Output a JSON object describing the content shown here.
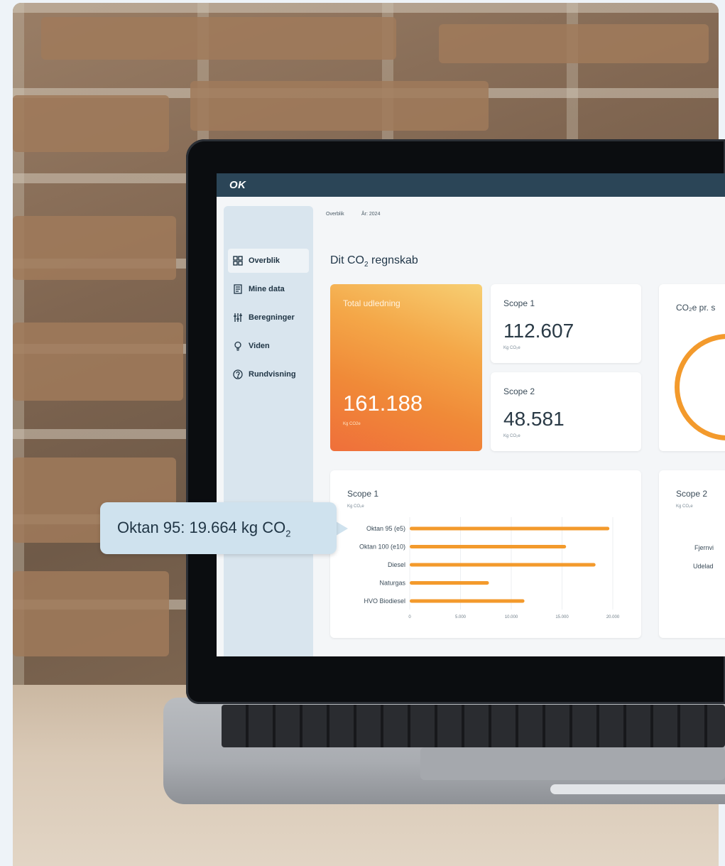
{
  "app": {
    "logo": "OK",
    "breadcrumb": {
      "page": "Overblik",
      "year": "År: 2024"
    },
    "title_main": "Dit CO",
    "title_sub": "2",
    "title_rest": " regnskab"
  },
  "sidebar": {
    "items": [
      {
        "label": "Overblik",
        "icon": "grid-icon",
        "active": true
      },
      {
        "label": "Mine data",
        "icon": "document-icon",
        "active": false
      },
      {
        "label": "Beregninger",
        "icon": "sliders-icon",
        "active": false
      },
      {
        "label": "Viden",
        "icon": "lightbulb-icon",
        "active": false
      },
      {
        "label": "Rundvisning",
        "icon": "help-circle-icon",
        "active": false
      }
    ]
  },
  "cards": {
    "total": {
      "title": "Total udledning",
      "value": "161.188",
      "unit": "Kg CO2e"
    },
    "scope1": {
      "title": "Scope 1",
      "value": "112.607",
      "unit": "Kg CO₂e"
    },
    "scope2": {
      "title": "Scope 2",
      "value": "48.581",
      "unit": "Kg CO₂e"
    },
    "co2_per": {
      "title": "CO₂e pr. s"
    },
    "scope2_chart": {
      "title": "Scope 2",
      "unit": "Kg CO₂e",
      "labels": [
        "Fjernvi",
        "Udelad"
      ]
    }
  },
  "tooltip": {
    "text": "Oktan 95: 19.664 kg CO",
    "sub": "2"
  },
  "chart_data": {
    "type": "bar",
    "orientation": "horizontal",
    "title": "Scope 1",
    "xlabel": "Kg CO₂e",
    "categories": [
      "Oktan 95 (e5)",
      "Oktan 100 (e10)",
      "Diesel",
      "Naturgas",
      "HVO Biodiesel"
    ],
    "values": [
      19664,
      15400,
      18300,
      7800,
      11300
    ],
    "xlim": [
      0,
      20000
    ],
    "xticks": [
      "0",
      "5.000",
      "10.000",
      "15.000",
      "20.000"
    ],
    "bar_color": "#f39a2c"
  },
  "colors": {
    "topbar": "#2b4557",
    "accent": "#f39a2c"
  }
}
